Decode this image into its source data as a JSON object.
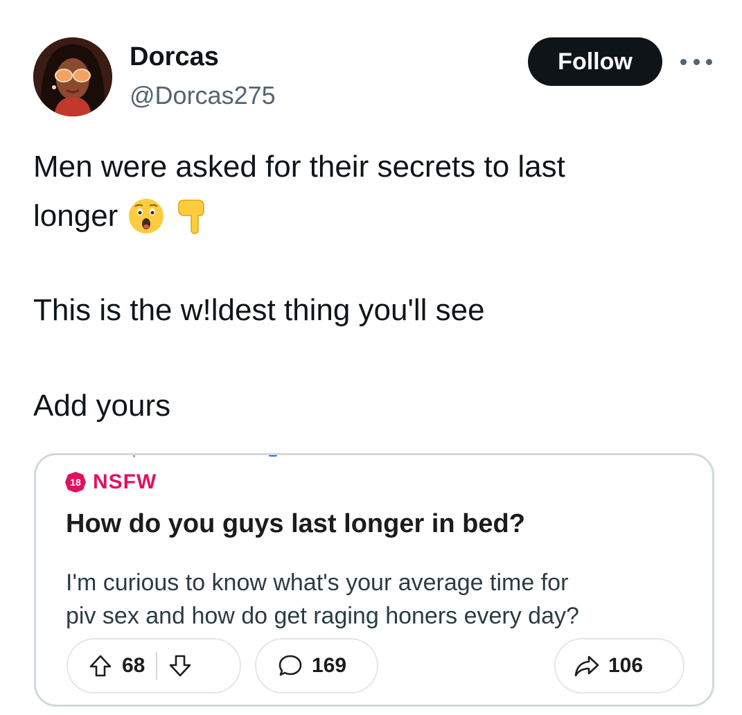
{
  "author": {
    "display_name": "Dorcas",
    "handle": "@Dorcas275",
    "avatar_icon": "avatar-illustration"
  },
  "actions": {
    "follow_label": "Follow",
    "more_icon": "more-horizontal-icon"
  },
  "tweet": {
    "line1": "Men were asked for their secrets to last",
    "line2": "longer",
    "line2_emojis": [
      "astonished-face-emoji",
      "pointing-down-emoji"
    ],
    "line3": "This is the w!ldest thing you'll see",
    "line4": "Add yours"
  },
  "card": {
    "badge_number": "18",
    "badge_label": "NSFW",
    "title": "How do you guys last longer in bed?",
    "body_line1": "I'm curious to know what's your average time for",
    "body_line2": "piv sex and how do get raging honers every day?",
    "upvotes": "68",
    "comments": "169",
    "shares": "106"
  },
  "colors": {
    "follow_bg": "#0f1419",
    "nsfw": "#e0115f",
    "handle": "#536471",
    "card_border": "#cfd9de"
  }
}
